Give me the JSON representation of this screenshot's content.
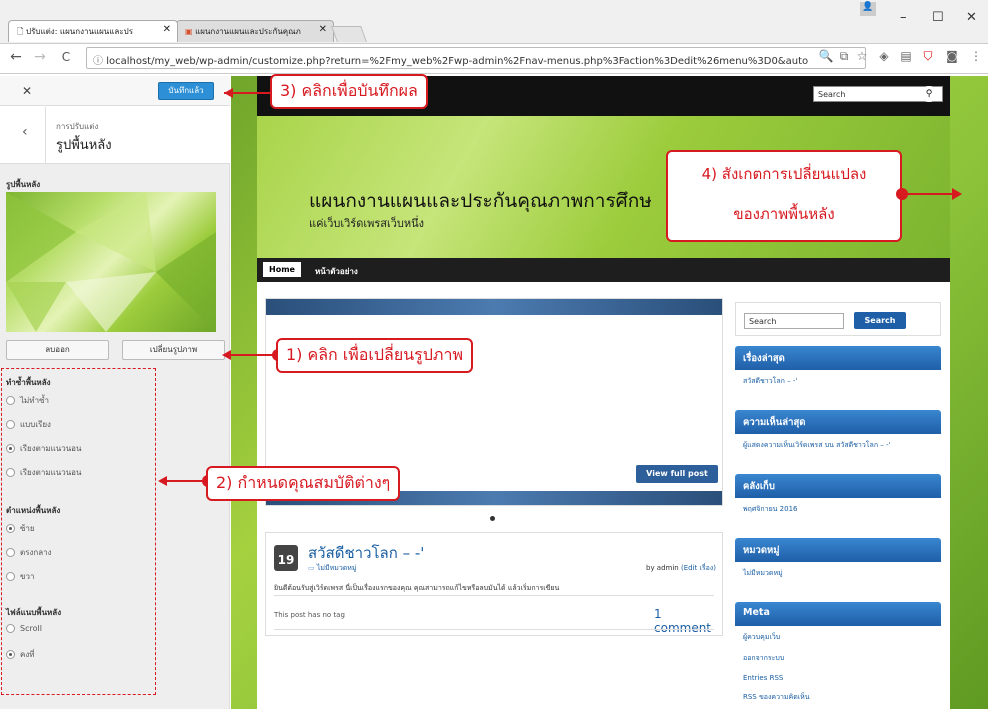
{
  "browser": {
    "tabs": [
      {
        "label": "ปรับแต่ง: แผนกงานแผนและปร"
      },
      {
        "label": "แผนกงานแผนและประกันคุณภ"
      }
    ],
    "url": "localhost/my_web/wp-admin/customize.php?return=%2Fmy_web%2Fwp-admin%2Fnav-menus.php%3Faction%3Dedit%26menu%3D0&auto"
  },
  "customizer": {
    "save_label": "บันทึกแล้ว",
    "breadcrumb": "การปรับแต่ง",
    "section_title": "รูปพื้นหลัง",
    "image_label": "รูปพื้นหลัง",
    "remove_label": "ลบออก",
    "change_label": "เปลี่ยนรูปภาพ",
    "repeat": {
      "title": "ทำซ้ำพื้นหลัง",
      "options": [
        "ไม่ทำซ้ำ",
        "แบบเรียง",
        "เรียงตามแนวนอน",
        "เรียงตามแนวนอน"
      ]
    },
    "position": {
      "title": "ตำแหน่งพื้นหลัง",
      "options": [
        "ซ้าย",
        "ตรงกลาง",
        "ขวา"
      ]
    },
    "attachment": {
      "title": "ไฟล์แนบพื้นหลัง",
      "options": [
        "Scroll",
        "คงที่"
      ]
    }
  },
  "site": {
    "search_placeholder": "Search",
    "title": "แผนกงานแผนและประกันคุณภาพการศึกษ",
    "tagline": "แค่เว็บเวิร์ดเพรสเว็บหนึ่ง",
    "menu": [
      "Home",
      "หน้าตัวอย่าง"
    ],
    "view_full_post": "View full post",
    "post": {
      "day": "19",
      "title": "สวัสดีชาวโลก – -'",
      "category": "ไม่มีหมวดหมู่",
      "byline": "by admin",
      "edit": "(Edit เรื่อง)",
      "excerpt": "ยินดีต้อนรับสู่เวิร์ดเพรส นี่เป็นเรื่องแรกของคุณ คุณสามารถแก้ไขหรือลบมันได้ แล้วเริ่มการเขียน",
      "tags": "This post has no tag",
      "comments": "1 comment"
    },
    "sidebar": {
      "search_placeholder": "Search",
      "search_button": "Search",
      "widgets": [
        {
          "title": "เรื่องล่าสุด",
          "links": [
            "สวัสดีชาวโลก – -'"
          ]
        },
        {
          "title": "ความเห็นล่าสุด",
          "links": [
            "ผู้แสดงความเห็นเวิร์ดเพรส บน สวัสดีชาวโลก – -'"
          ]
        },
        {
          "title": "คลังเก็บ",
          "links": [
            "พฤศจิกายน 2016"
          ]
        },
        {
          "title": "หมวดหมู่",
          "links": [
            "ไม่มีหมวดหมู่"
          ]
        },
        {
          "title": "Meta",
          "links": [
            "ผู้ควบคุมเว็บ",
            "ออกจากระบบ",
            "Entries RSS",
            "RSS ของความคิดเห็น"
          ]
        }
      ]
    }
  },
  "annotations": {
    "a1": "1) คลิก เพื่อเปลี่ยนรูปภาพ",
    "a2": "2) กำหนดคุณสมบัติต่างๆ",
    "a3": "3) คลิกเพื่อบันทึกผล",
    "a4_line1": "4) สังเกตการเปลี่ยนแปลง",
    "a4_line2": "ของภาพพื้นหลัง"
  },
  "colors": {
    "accent": "#d71920",
    "wp_blue": "#2d8fd5",
    "widget_blue": "#2a6fbf"
  }
}
